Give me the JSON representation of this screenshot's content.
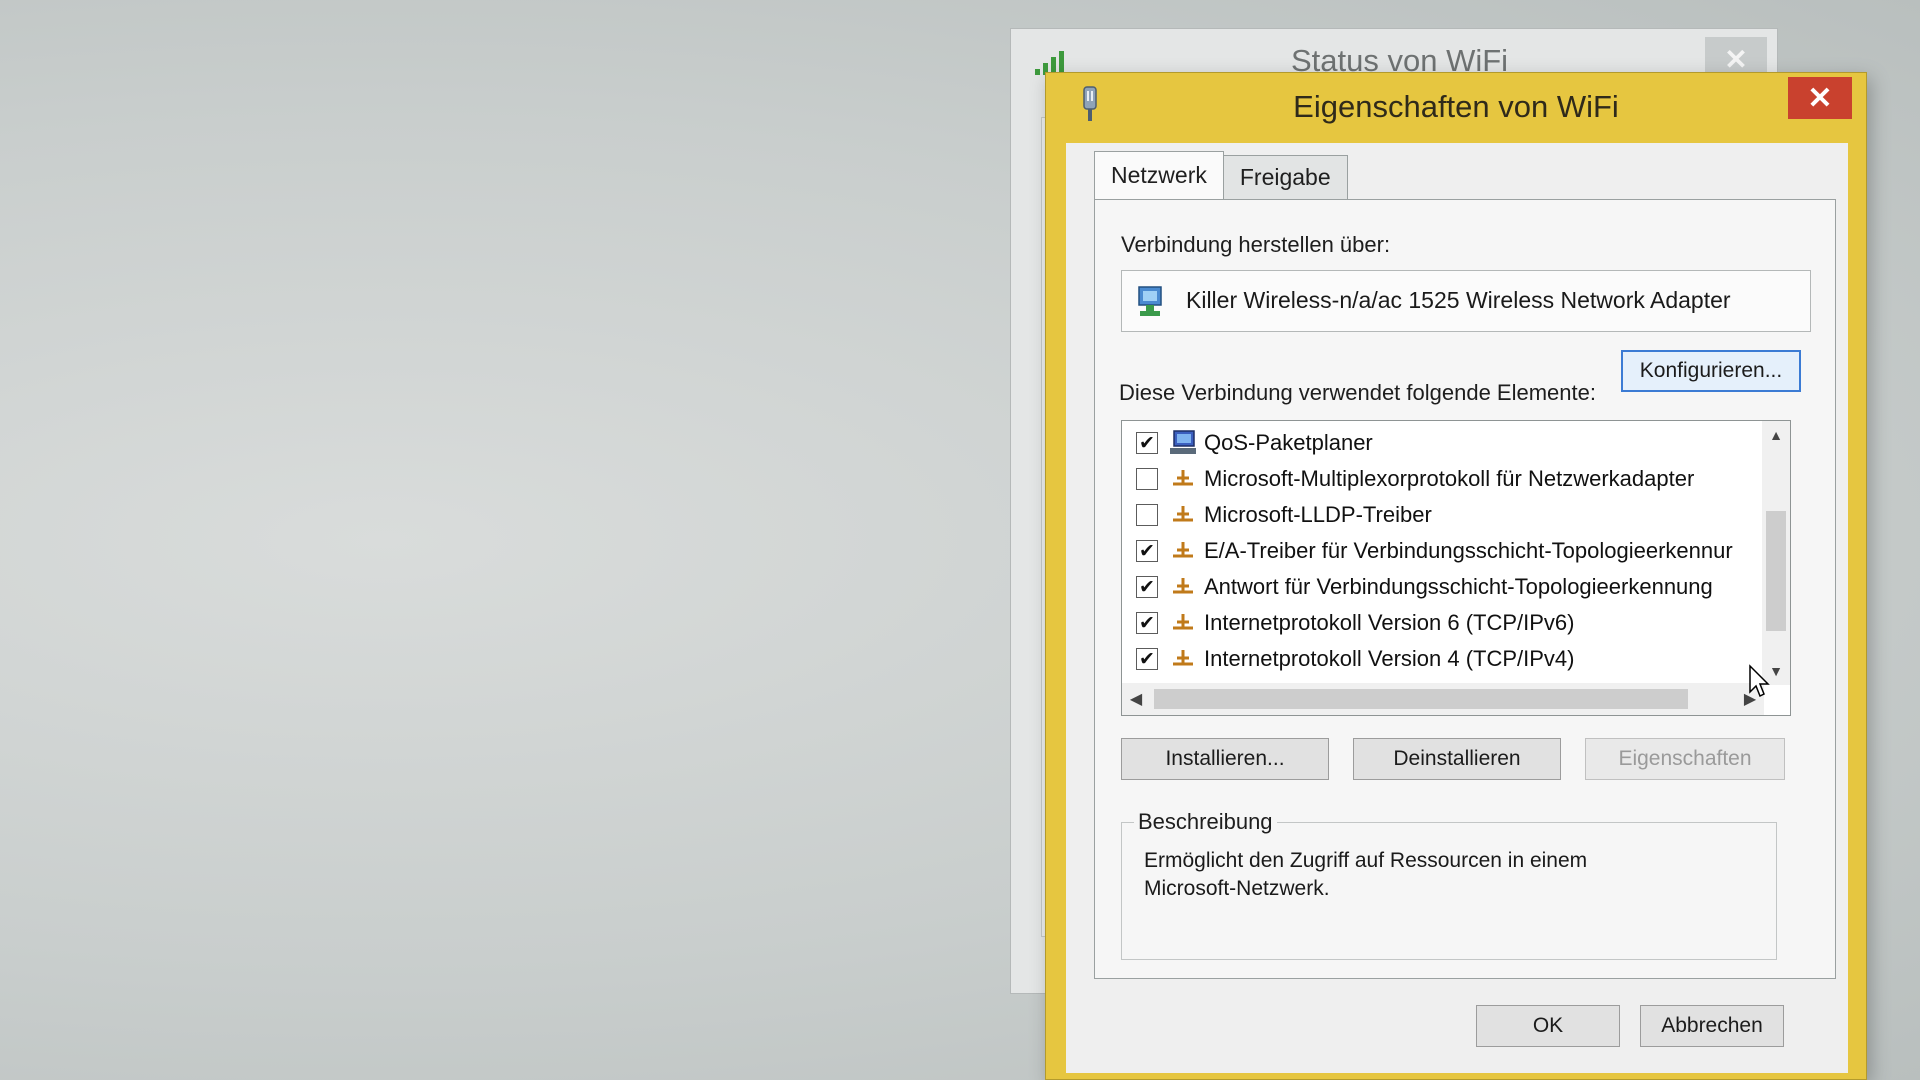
{
  "status_window": {
    "title": "Status von WiFi",
    "close_glyph": "✕"
  },
  "dialog": {
    "title": "Eigenschaften von WiFi",
    "close_glyph": "✕",
    "tabs": [
      {
        "label": "Netzwerk",
        "active": true
      },
      {
        "label": "Freigabe",
        "active": false
      }
    ],
    "connect_via_label": "Verbindung herstellen über:",
    "adapter_name": "Killer Wireless-n/a/ac 1525 Wireless Network Adapter",
    "configure_button": "Konfigurieren...",
    "items_label": "Diese Verbindung verwendet folgende Elemente:",
    "items": [
      {
        "label": "QoS-Paketplaner",
        "checked": true,
        "icon": "qos-scheduler-icon"
      },
      {
        "label": "Microsoft-Multiplexorprotokoll für Netzwerkadapter",
        "checked": false,
        "icon": "protocol-icon"
      },
      {
        "label": "Microsoft-LLDP-Treiber",
        "checked": false,
        "icon": "protocol-icon"
      },
      {
        "label": "E/A-Treiber für Verbindungsschicht-Topologieerkennur",
        "checked": true,
        "icon": "protocol-icon"
      },
      {
        "label": "Antwort für Verbindungsschicht-Topologieerkennung",
        "checked": true,
        "icon": "protocol-icon"
      },
      {
        "label": "Internetprotokoll Version 6 (TCP/IPv6)",
        "checked": true,
        "icon": "protocol-icon"
      },
      {
        "label": "Internetprotokoll Version 4 (TCP/IPv4)",
        "checked": true,
        "icon": "protocol-icon"
      }
    ],
    "check_glyph": "✔",
    "install_button": "Installieren...",
    "uninstall_button": "Deinstallieren",
    "properties_button": "Eigenschaften",
    "description_legend": "Beschreibung",
    "description_text": "Ermöglicht den Zugriff auf Ressourcen in einem Microsoft-Netzwerk.",
    "ok_button": "OK",
    "cancel_button": "Abbrechen",
    "scroll_glyphs": {
      "up": "▲",
      "down": "▼",
      "left": "◀",
      "right": "▶"
    }
  },
  "colors": {
    "accent_border": "#e6c640",
    "close_red": "#c9412e",
    "focus_blue": "#3b7bd4"
  }
}
